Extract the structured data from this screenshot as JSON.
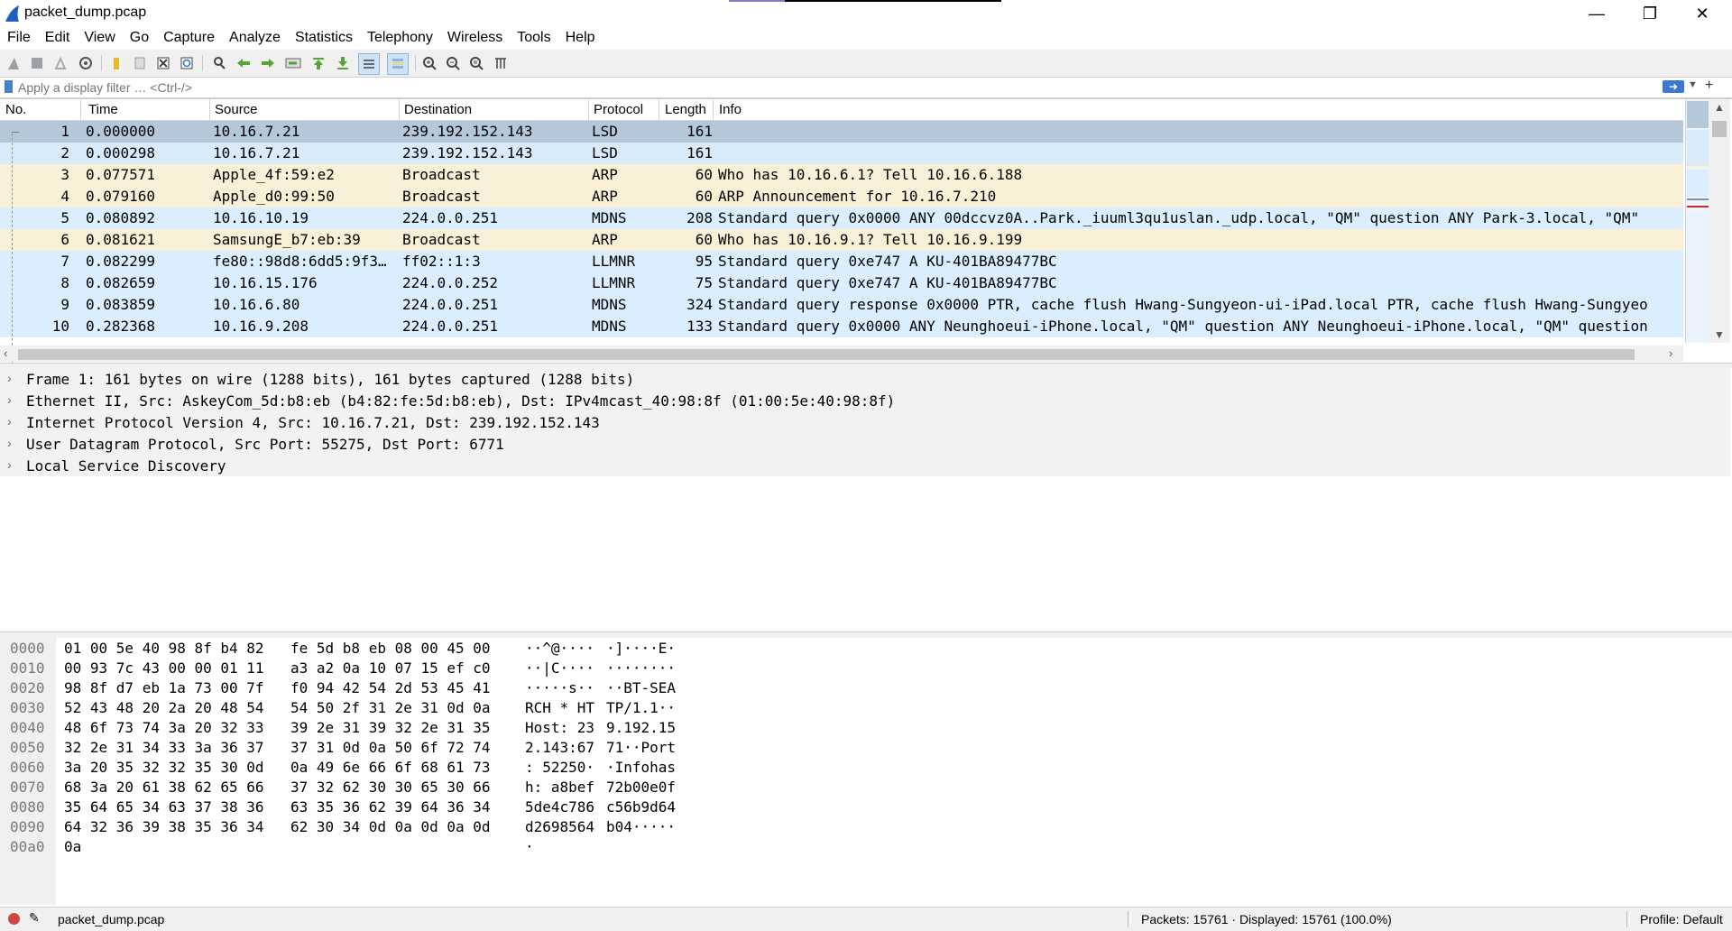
{
  "window": {
    "title": "packet_dump.pcap",
    "controls": [
      "—",
      "❐",
      "✕"
    ]
  },
  "menu": [
    "File",
    "Edit",
    "View",
    "Go",
    "Capture",
    "Analyze",
    "Statistics",
    "Telephony",
    "Wireless",
    "Tools",
    "Help"
  ],
  "toolbar": {
    "icons": [
      "start-capture-icon",
      "stop-capture-icon",
      "restart-capture-icon",
      "capture-options-icon",
      "open-file-icon",
      "save-file-icon",
      "close-file-icon",
      "reload-file-icon",
      "find-packet-icon",
      "go-back-icon",
      "go-forward-icon",
      "go-to-packet-icon",
      "first-packet-icon",
      "last-packet-icon",
      "autoscroll-icon",
      "colorize-icon",
      "zoom-in-icon",
      "zoom-out-icon",
      "normal-size-icon",
      "resize-columns-icon"
    ]
  },
  "filter": {
    "placeholder": "Apply a display filter … <Ctrl-/>"
  },
  "packet_list": {
    "columns": [
      "No.",
      "Time",
      "Source",
      "Destination",
      "Protocol",
      "Length",
      "Info"
    ],
    "rows": [
      {
        "no": "1",
        "time": "0.000000",
        "src": "10.16.7.21",
        "dst": "239.192.152.143",
        "proto": "LSD",
        "len": "161",
        "info": "",
        "style": "sel"
      },
      {
        "no": "2",
        "time": "0.000298",
        "src": "10.16.7.21",
        "dst": "239.192.152.143",
        "proto": "LSD",
        "len": "161",
        "info": "",
        "style": "lsd"
      },
      {
        "no": "3",
        "time": "0.077571",
        "src": "Apple_4f:59:e2",
        "dst": "Broadcast",
        "proto": "ARP",
        "len": "60",
        "info": "Who has 10.16.6.1? Tell 10.16.6.188",
        "style": "arp"
      },
      {
        "no": "4",
        "time": "0.079160",
        "src": "Apple_d0:99:50",
        "dst": "Broadcast",
        "proto": "ARP",
        "len": "60",
        "info": "ARP Announcement for 10.16.7.210",
        "style": "arp"
      },
      {
        "no": "5",
        "time": "0.080892",
        "src": "10.16.10.19",
        "dst": "224.0.0.251",
        "proto": "MDNS",
        "len": "208",
        "info": "Standard query 0x0000 ANY 00dccvz0A..Park._iuuml3qu1uslan._udp.local, \"QM\" question ANY Park-3.local, \"QM\"",
        "style": "udp"
      },
      {
        "no": "6",
        "time": "0.081621",
        "src": "SamsungE_b7:eb:39",
        "dst": "Broadcast",
        "proto": "ARP",
        "len": "60",
        "info": "Who has 10.16.9.1? Tell 10.16.9.199",
        "style": "arp"
      },
      {
        "no": "7",
        "time": "0.082299",
        "src": "fe80::98d8:6dd5:9f3…",
        "dst": "ff02::1:3",
        "proto": "LLMNR",
        "len": "95",
        "info": "Standard query 0xe747 A KU-401BA89477BC",
        "style": "udp"
      },
      {
        "no": "8",
        "time": "0.082659",
        "src": "10.16.15.176",
        "dst": "224.0.0.252",
        "proto": "LLMNR",
        "len": "75",
        "info": "Standard query 0xe747 A KU-401BA89477BC",
        "style": "udp"
      },
      {
        "no": "9",
        "time": "0.083859",
        "src": "10.16.6.80",
        "dst": "224.0.0.251",
        "proto": "MDNS",
        "len": "324",
        "info": "Standard query response 0x0000 PTR, cache flush Hwang-Sungyeon-ui-iPad.local PTR, cache flush Hwang-Sungyeo",
        "style": "udp"
      },
      {
        "no": "10",
        "time": "0.282368",
        "src": "10.16.9.208",
        "dst": "224.0.0.251",
        "proto": "MDNS",
        "len": "133",
        "info": "Standard query 0x0000 ANY Neunghoeui-iPhone.local, \"QM\" question ANY Neunghoeui-iPhone.local, \"QM\" question",
        "style": "udp"
      }
    ]
  },
  "details": [
    "Frame 1: 161 bytes on wire (1288 bits), 161 bytes captured (1288 bits)",
    "Ethernet II, Src: AskeyCom_5d:b8:eb (b4:82:fe:5d:b8:eb), Dst: IPv4mcast_40:98:8f (01:00:5e:40:98:8f)",
    "Internet Protocol Version 4, Src: 10.16.7.21, Dst: 239.192.152.143",
    "User Datagram Protocol, Src Port: 55275, Dst Port: 6771",
    "Local Service Discovery"
  ],
  "bytes": [
    {
      "off": "0000",
      "hex1": "01 00 5e 40 98 8f b4 82",
      "hex2": "fe 5d b8 eb 08 00 45 00",
      "asc1": "··^@····",
      "asc2": "·]····E·"
    },
    {
      "off": "0010",
      "hex1": "00 93 7c 43 00 00 01 11",
      "hex2": "a3 a2 0a 10 07 15 ef c0",
      "asc1": "··|C····",
      "asc2": "········"
    },
    {
      "off": "0020",
      "hex1": "98 8f d7 eb 1a 73 00 7f",
      "hex2": "f0 94 42 54 2d 53 45 41",
      "asc1": "·····s··",
      "asc2": "··BT-SEA"
    },
    {
      "off": "0030",
      "hex1": "52 43 48 20 2a 20 48 54",
      "hex2": "54 50 2f 31 2e 31 0d 0a",
      "asc1": "RCH * HT",
      "asc2": "TP/1.1··"
    },
    {
      "off": "0040",
      "hex1": "48 6f 73 74 3a 20 32 33",
      "hex2": "39 2e 31 39 32 2e 31 35",
      "asc1": "Host: 23",
      "asc2": "9.192.15"
    },
    {
      "off": "0050",
      "hex1": "32 2e 31 34 33 3a 36 37",
      "hex2": "37 31 0d 0a 50 6f 72 74",
      "asc1": "2.143:67",
      "asc2": "71··Port"
    },
    {
      "off": "0060",
      "hex1": "3a 20 35 32 32 35 30 0d",
      "hex2": "0a 49 6e 66 6f 68 61 73",
      "asc1": ": 52250·",
      "asc2": "·Infohas"
    },
    {
      "off": "0070",
      "hex1": "68 3a 20 61 38 62 65 66",
      "hex2": "37 32 62 30 30 65 30 66",
      "asc1": "h: a8bef",
      "asc2": "72b00e0f"
    },
    {
      "off": "0080",
      "hex1": "35 64 65 34 63 37 38 36",
      "hex2": "63 35 36 62 39 64 36 34",
      "asc1": "5de4c786",
      "asc2": "c56b9d64"
    },
    {
      "off": "0090",
      "hex1": "64 32 36 39 38 35 36 34",
      "hex2": "62 30 34 0d 0a 0d 0a 0d",
      "asc1": "d2698564",
      "asc2": "b04·····"
    },
    {
      "off": "00a0",
      "hex1": "0a",
      "hex2": "",
      "asc1": "·",
      "asc2": ""
    }
  ],
  "status": {
    "file": "packet_dump.pcap",
    "packets": "Packets: 15761 · Displayed: 15761 (100.0%)",
    "profile": "Profile: Default"
  },
  "colors": {
    "selected_row": "#b4c8d9",
    "lsd_row": "#d9eaf9",
    "arp_row": "#faf0d7",
    "udp_row": "#daeeff"
  }
}
